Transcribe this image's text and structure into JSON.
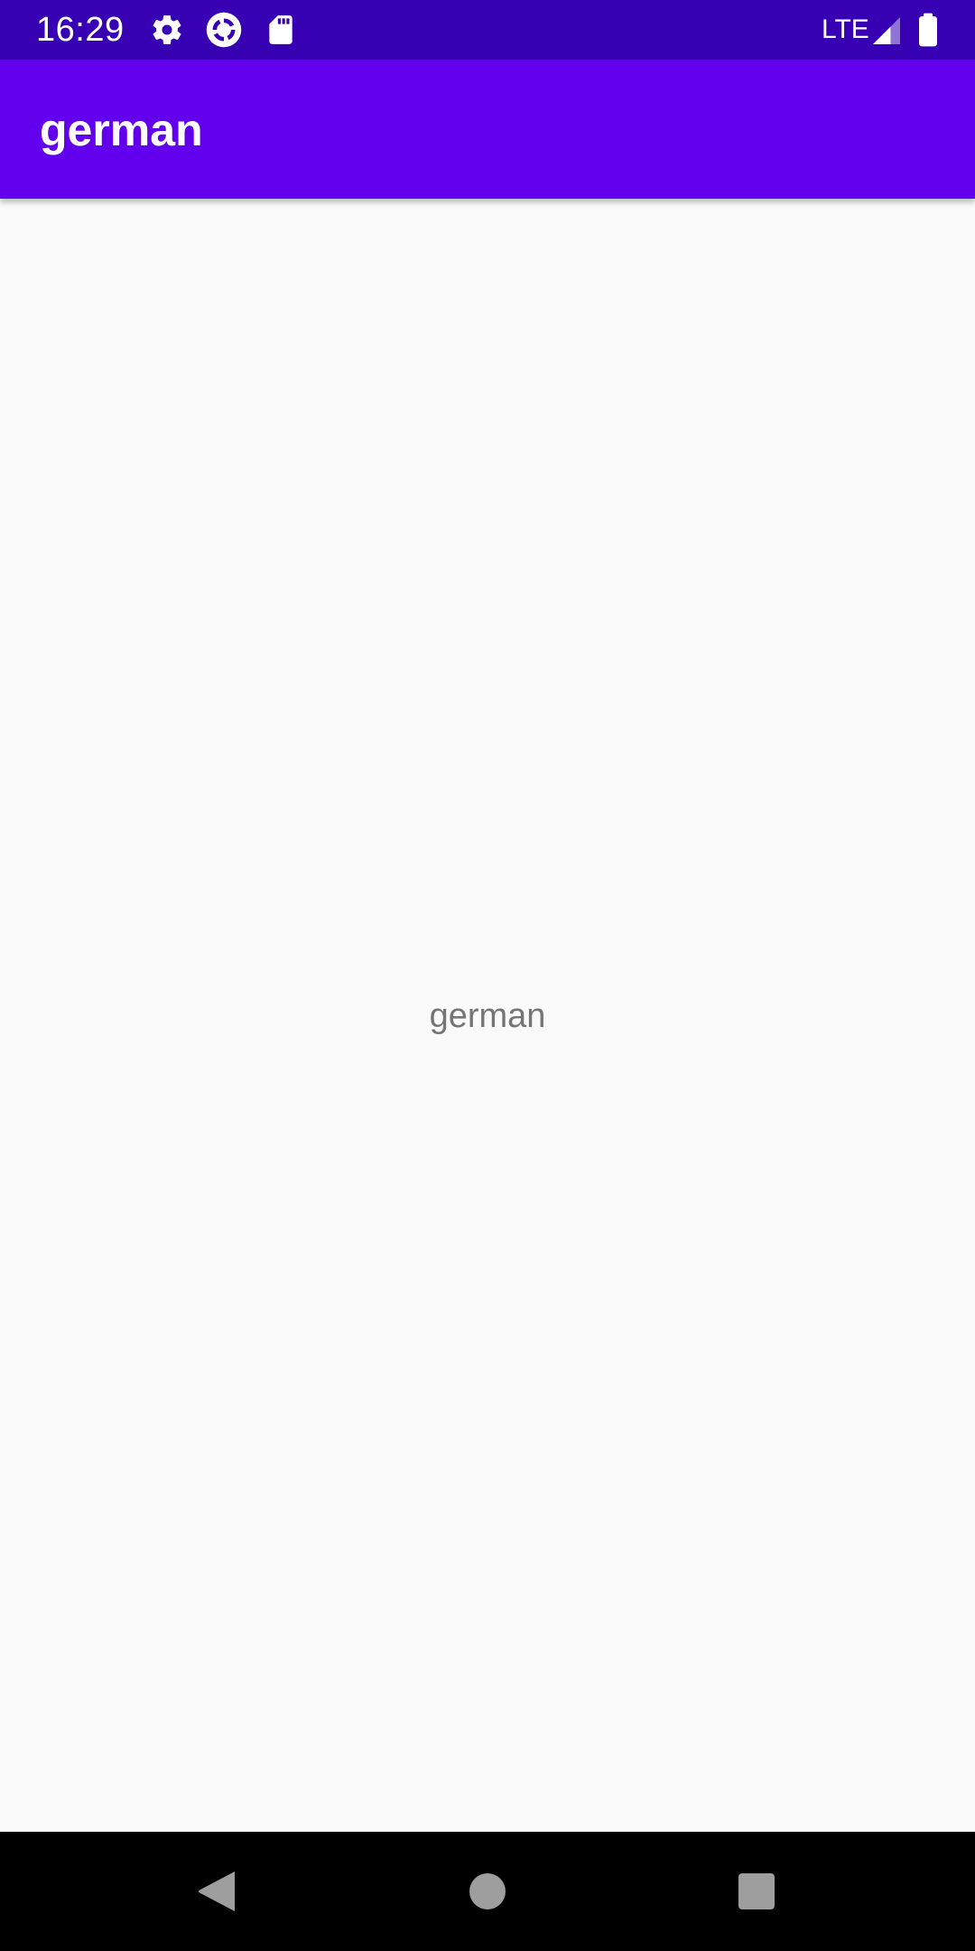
{
  "status_bar": {
    "time": "16:29",
    "network": "LTE",
    "icons": [
      "settings-icon",
      "sync-icon",
      "sd-card-icon",
      "signal-icon",
      "battery-icon"
    ]
  },
  "app_bar": {
    "title": "german",
    "color": "#6200ee"
  },
  "main": {
    "label": "german"
  },
  "nav_bar": {
    "buttons": [
      "back-icon",
      "home-icon",
      "recents-icon"
    ]
  },
  "colors": {
    "status_bar": "#3700b3",
    "app_bar": "#6200ee",
    "background": "#fafafa",
    "text_secondary": "#757575"
  }
}
